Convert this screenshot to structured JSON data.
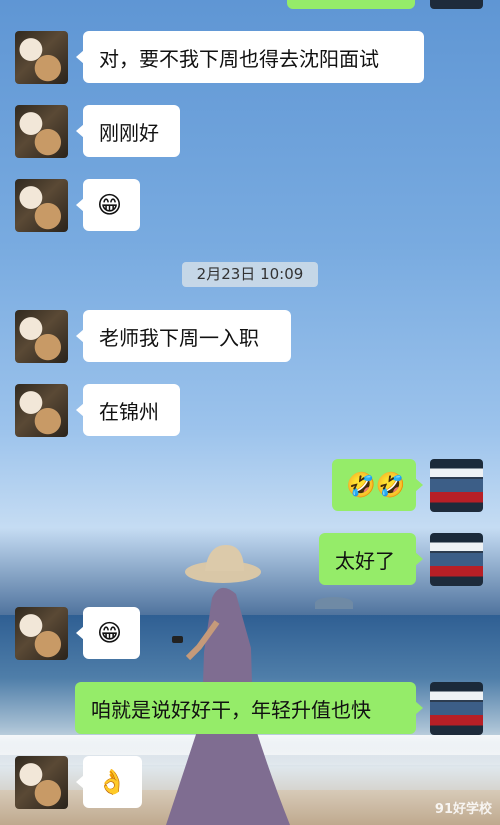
{
  "messages": [
    {
      "side": "right",
      "text": ""
    },
    {
      "side": "left",
      "text": "对，要不我下周也得去沈阳面试"
    },
    {
      "side": "left",
      "text": "刚刚好"
    },
    {
      "side": "left",
      "text": "😁"
    },
    {
      "side": "left",
      "text": "老师我下周一入职"
    },
    {
      "side": "left",
      "text": "在锦州"
    },
    {
      "side": "right",
      "text": "🤣🤣"
    },
    {
      "side": "right",
      "text": "太好了"
    },
    {
      "side": "left",
      "text": "😁"
    },
    {
      "side": "right",
      "text": "咱就是说好好干，年轻升值也快"
    },
    {
      "side": "left",
      "text": "👌"
    }
  ],
  "timestamp": "2月23日 10:09",
  "watermark": "91好学校"
}
